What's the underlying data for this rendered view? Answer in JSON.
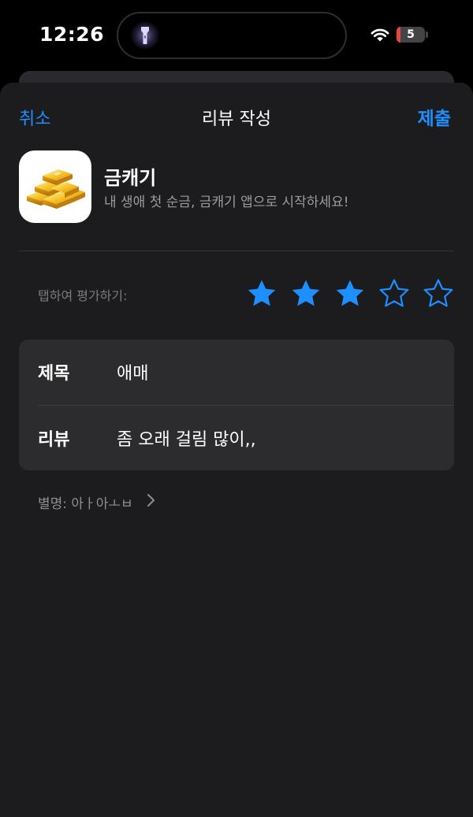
{
  "status_bar": {
    "time": "12:26",
    "battery_level": "5",
    "icons": [
      "flashlight-icon",
      "wifi-icon",
      "battery-icon"
    ]
  },
  "nav": {
    "cancel": "취소",
    "title": "리뷰 작성",
    "submit": "제출"
  },
  "app": {
    "name": "금캐기",
    "subtitle": "내 생애 첫 순금, 금캐기 앱으로 시작하세요!",
    "icon": "gold-bars-icon"
  },
  "rating": {
    "label": "탭하여 평가하기:",
    "value": 3,
    "max": 5
  },
  "form": {
    "title_label": "제목",
    "title_value": "애매",
    "review_label": "리뷰",
    "review_value": "좀 오래 걸림 많이,,"
  },
  "nickname": {
    "text": "별명: 아ㅏ아ㅗㅂ"
  },
  "colors": {
    "accent": "#1e8fff",
    "background": "#1c1c1e",
    "card": "#2c2c2e",
    "battery_low": "#e8463f"
  }
}
